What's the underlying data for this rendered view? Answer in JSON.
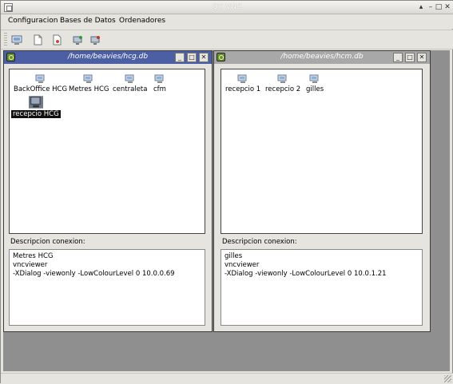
{
  "window": {
    "title": "QT VNC"
  },
  "menu": [
    "Configuracion",
    "Bases de Datos",
    "Ordenadores"
  ],
  "toolbar": {
    "icons": [
      "connect-icon",
      "new-document-icon",
      "edit-document-icon",
      "add-computer-icon",
      "remove-computer-icon"
    ]
  },
  "windows": [
    {
      "title": "/home/beavies/hcg.db",
      "hosts": [
        "BackOffice HCG",
        "Metres HCG",
        "centraleta",
        "cfm",
        "recepcio HCG"
      ],
      "selected": "recepcio HCG",
      "desc_label": "Descripcion conexion:",
      "description": [
        "Metres HCG",
        "vncviewer",
        "-XDialog -viewonly -LowColourLevel 0 10.0.0.69"
      ]
    },
    {
      "title": "/home/beavies/hcm.db",
      "hosts": [
        "recepcio 1",
        "recepcio 2",
        "gilles"
      ],
      "desc_label": "Descripcion conexion:",
      "description": [
        "gilles",
        "vncviewer",
        "-XDialog -viewonly -LowColourLevel 0 10.0.1.21"
      ]
    }
  ],
  "colors": {
    "active_title": "#4c5fa5",
    "inactive_title": "#a8a8a8",
    "mdi_background": "#8f8f8f"
  }
}
